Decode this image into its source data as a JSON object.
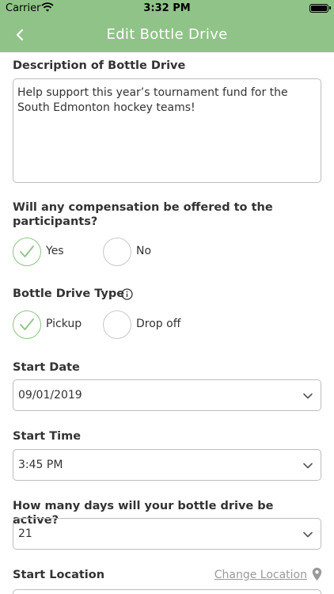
{
  "status_bar": {
    "carrier": "Carrier",
    "time": "3:32 PM"
  },
  "nav": {
    "title": "Edit Bottle Drive",
    "back_icon": "chevron-left-icon"
  },
  "description": {
    "label": "Description of Bottle Drive",
    "value": "Help support this year’s tournament fund for the South Edmonton hockey teams!"
  },
  "compensation": {
    "question": "Will any compensation be offered to the participants?",
    "options": [
      {
        "label": "Yes",
        "selected": true
      },
      {
        "label": "No",
        "selected": false
      }
    ]
  },
  "drive_type": {
    "label": "Bottle Drive Type",
    "options": [
      {
        "label": "Pickup",
        "selected": true
      },
      {
        "label": "Drop off",
        "selected": false
      }
    ]
  },
  "start_date": {
    "label": "Start Date",
    "value": "09/01/2019"
  },
  "start_time": {
    "label": "Start Time",
    "value": "3:45 PM"
  },
  "days_active": {
    "label": "How many days will your bottle drive be active?",
    "value": "21"
  },
  "start_location": {
    "label": "Start Location",
    "change_link": "Change Location"
  },
  "colors": {
    "accent": "#8fc387",
    "border": "#bdbdbd",
    "link": "#9a9a9a"
  }
}
